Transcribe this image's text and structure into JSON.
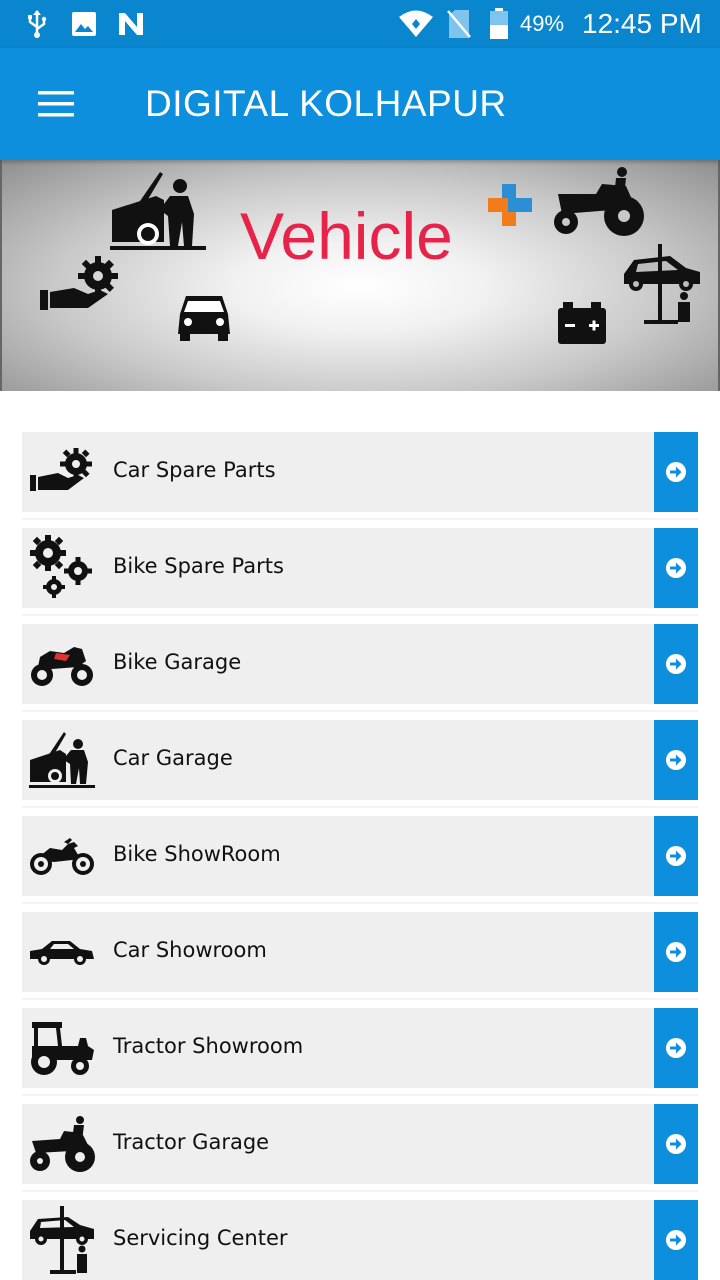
{
  "status_bar": {
    "battery_percent": "49%",
    "time": "12:45 PM",
    "icons": [
      "usb-icon",
      "image-icon",
      "n-app-icon",
      "wifi-icon",
      "no-sim-icon",
      "battery-icon"
    ]
  },
  "app_bar": {
    "title": "DIGITAL KOLHAPUR",
    "menu_icon": "hamburger-menu-icon"
  },
  "banner": {
    "title": "Vehicle",
    "title_color": "#e8234a",
    "icons": [
      "mechanic-car-icon",
      "hand-gear-icon",
      "car-front-icon",
      "medical-plus-icon",
      "tractor-driver-icon",
      "car-battery-icon",
      "car-lift-icon"
    ]
  },
  "colors": {
    "accent": "#0e8fde",
    "item_bg": "#efefef"
  },
  "items": [
    {
      "label": "Car Spare Parts",
      "icon": "hand-gear-icon"
    },
    {
      "label": "Bike Spare Parts",
      "icon": "gears-icon"
    },
    {
      "label": "Bike Garage",
      "icon": "sport-bike-icon"
    },
    {
      "label": "Car Garage",
      "icon": "mechanic-car-icon"
    },
    {
      "label": "Bike ShowRoom",
      "icon": "motorbike-icon"
    },
    {
      "label": "Car Showroom",
      "icon": "sedan-car-icon"
    },
    {
      "label": "Tractor Showroom",
      "icon": "tractor-icon"
    },
    {
      "label": "Tractor Garage",
      "icon": "tractor-driver-icon"
    },
    {
      "label": "Servicing Center",
      "icon": "car-lift-icon"
    }
  ]
}
